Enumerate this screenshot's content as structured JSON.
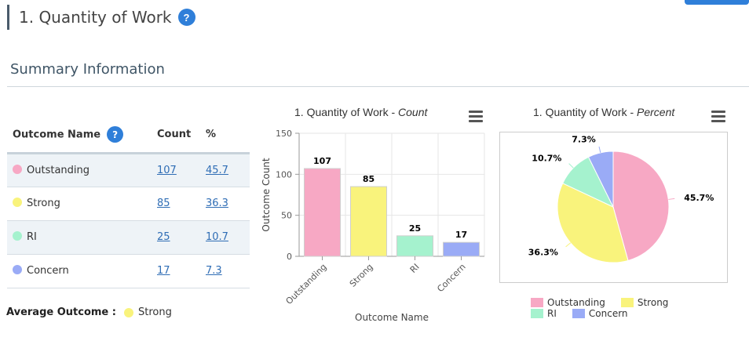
{
  "page": {
    "title": "1. Quantity of Work",
    "help_label": "?"
  },
  "summary": {
    "title": "Summary Information"
  },
  "table": {
    "headers": {
      "name": "Outcome Name",
      "count": "Count",
      "percent": "%",
      "help_label": "?"
    },
    "rows": [
      {
        "name": "Outstanding",
        "count": "107",
        "percent": "45.7",
        "color": "#f7a8c4"
      },
      {
        "name": "Strong",
        "count": "85",
        "percent": "36.3",
        "color": "#f9f37c"
      },
      {
        "name": "RI",
        "count": "25",
        "percent": "10.7",
        "color": "#a5f2ce"
      },
      {
        "name": "Concern",
        "count": "17",
        "percent": "7.3",
        "color": "#9aabf6"
      }
    ]
  },
  "average": {
    "label": "Average Outcome :",
    "value": "Strong",
    "color": "#f9f37c"
  },
  "chart_data": [
    {
      "type": "bar",
      "title": "1. Quantity of Work - ",
      "title_italic": "Count",
      "categories": [
        "Outstanding",
        "Strong",
        "RI",
        "Concern"
      ],
      "values": [
        107,
        85,
        25,
        17
      ],
      "colors": [
        "#f7a8c4",
        "#f9f37c",
        "#a5f2ce",
        "#9aabf6"
      ],
      "xlabel": "Outcome Name",
      "ylabel": "Outcome Count",
      "ylim": [
        0,
        150
      ],
      "yticks": [
        0,
        50,
        100,
        150
      ],
      "grid": true
    },
    {
      "type": "pie",
      "title": "1. Quantity of Work - ",
      "title_italic": "Percent",
      "categories": [
        "Outstanding",
        "Strong",
        "RI",
        "Concern"
      ],
      "values": [
        45.7,
        36.3,
        10.7,
        7.3
      ],
      "labels": [
        "45.7%",
        "36.3%",
        "10.7%",
        "7.3%"
      ],
      "colors": [
        "#f7a8c4",
        "#f9f37c",
        "#a5f2ce",
        "#9aabf6"
      ],
      "legend_position": "bottom"
    }
  ]
}
